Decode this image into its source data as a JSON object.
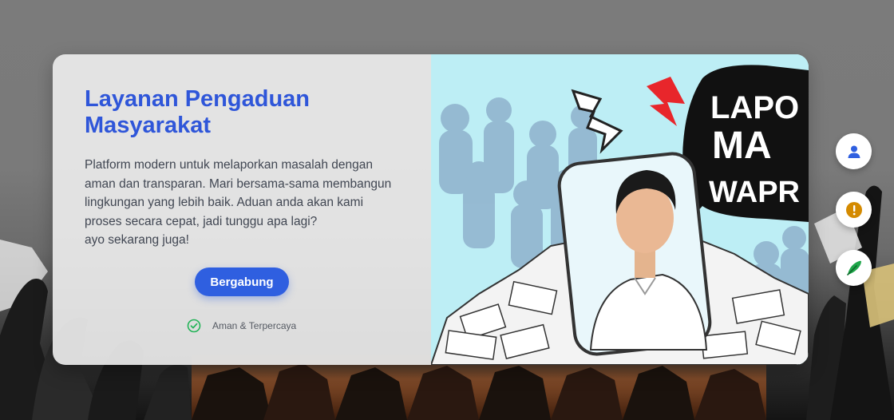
{
  "hero": {
    "title": "Layanan Pengaduan Masyarakat",
    "description_lines": [
      "Platform modern untuk melaporkan masalah dengan",
      "aman dan transparan. Mari bersama-sama membangun",
      "lingkungan yang lebih baik. Aduan anda akan kami",
      "proses secara cepat, jadi tunggu apa lagi?",
      "ayo sekarang juga!"
    ],
    "cta_label": "Bergabung",
    "trust_label": "Aman & Terpercaya"
  },
  "illustration": {
    "speech_bubble_lines": [
      "LAPO",
      "MA",
      "WAPR"
    ]
  },
  "floating_actions": [
    {
      "name": "profile",
      "icon": "user-icon",
      "color": "#2f5fe0"
    },
    {
      "name": "report",
      "icon": "alert-icon",
      "color": "#d48a00"
    },
    {
      "name": "write",
      "icon": "feather-icon",
      "color": "#1fa64a"
    }
  ],
  "colors": {
    "brand": "#2f56d9",
    "button": "#2f5fe0",
    "success": "#22b357"
  }
}
